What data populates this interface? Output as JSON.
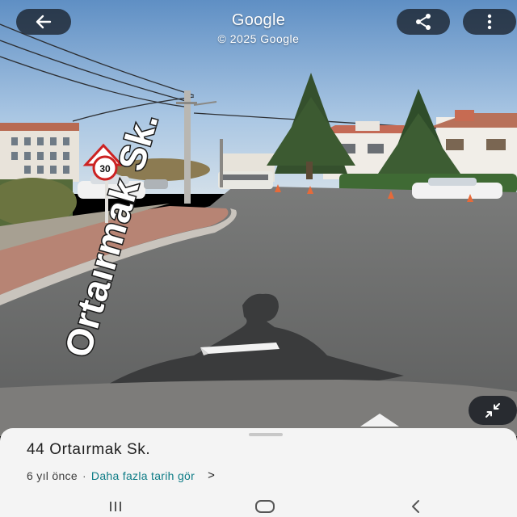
{
  "header": {
    "title": "Google",
    "subtitle": "© 2025 Google"
  },
  "street_sign": {
    "text": "Ortaırmak Sk.",
    "speed_limit": "30"
  },
  "place": {
    "address": "44 Ortaırmak Sk.",
    "age": "6 yıl önce",
    "separator": "·",
    "history_link": "Daha fazla tarih gör",
    "chevron": ">"
  },
  "icons": {
    "back": "arrow-left-icon",
    "share": "share-icon",
    "more": "more-vert-icon",
    "compass": "collapse-arrows-icon",
    "nav_recents": "recent-apps-icon",
    "nav_home": "home-icon",
    "nav_back": "nav-back-icon"
  },
  "colors": {
    "sky": "#9fc1e2",
    "road": "#6e6f6e",
    "link": "#0e7c86",
    "sheet": "#f4f4f4"
  }
}
